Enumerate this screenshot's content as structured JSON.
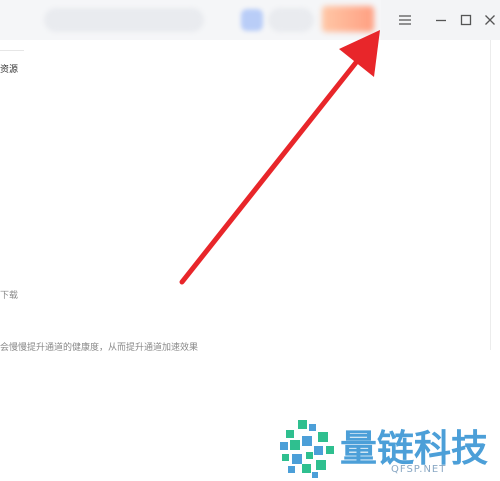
{
  "window_controls": {
    "menu_icon": "hamburger-menu-icon",
    "minimize_icon": "minimize-icon",
    "maximize_icon": "maximize-icon",
    "close_icon": "close-icon"
  },
  "content": {
    "fragment_resources": "资源",
    "fragment_download": "下载",
    "fragment_channel_note": "会慢慢提升通道的健康度，从而提升通道加速效果"
  },
  "watermark": {
    "brand_name": "量链科技",
    "url": "QFSP.NET"
  },
  "annotation": {
    "arrow_color": "#e8262a",
    "points_to": "hamburger-menu-icon"
  },
  "colors": {
    "logo_blue": "#4c9fd8",
    "logo_green": "#2fbf8f"
  }
}
